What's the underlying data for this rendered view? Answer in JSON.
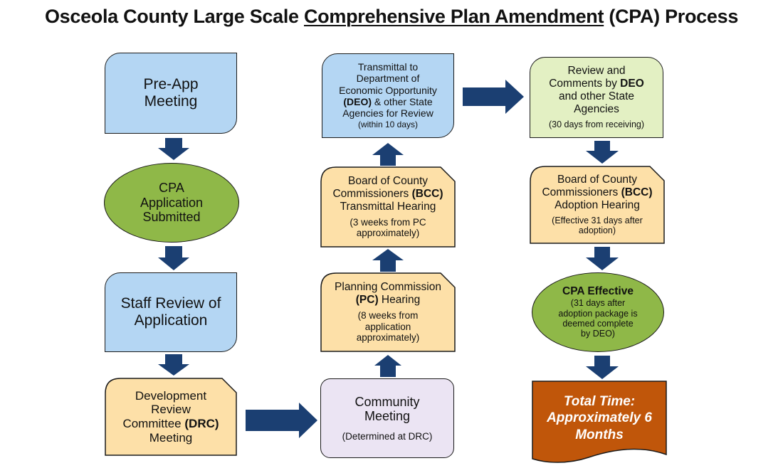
{
  "title": {
    "prefix": "Osceola County Large Scale ",
    "underlined": "Comprehensive Plan Amendment",
    "suffix": " (CPA) Process"
  },
  "colors": {
    "arrow": "#1b3f72",
    "blue_box": "#b4d6f3",
    "peach_box": "#fde0a8",
    "lavender_box": "#ebe4f3",
    "lime_box": "#e3f0c3",
    "green_ellipse": "#8fb848",
    "total_time_box": "#c0560a"
  },
  "steps": {
    "pre_app": {
      "line1": "Pre-App",
      "line2": "Meeting"
    },
    "cpa_submitted": {
      "line1": "CPA",
      "line2": "Application",
      "line3": "Submitted"
    },
    "staff_review": {
      "line1": "Staff Review of",
      "line2": "Application"
    },
    "drc": {
      "line1": "Development",
      "line2": "Review",
      "line3a": "Committee ",
      "line3b": "(DRC)",
      "line4": "Meeting"
    },
    "community": {
      "line1": "Community",
      "line2": "Meeting",
      "note": "(Determined at DRC)"
    },
    "pc_hearing": {
      "line1": "Planning Commission",
      "line2b": "(PC)",
      "line2": " Hearing",
      "note1": "(8 weeks from",
      "note2": "application",
      "note3": "approximately)"
    },
    "bcc_transmittal": {
      "line1": "Board of County",
      "line2a": "Commissioners ",
      "line2b": "(BCC)",
      "line3": "Transmittal Hearing",
      "note1": "(3 weeks from PC",
      "note2": "approximately)"
    },
    "transmittal_deo": {
      "line1": "Transmittal to",
      "line2": "Department of",
      "line3": "Economic Opportunity",
      "line4b": "(DEO)",
      "line4": " & other State",
      "line5": "Agencies for Review",
      "note": "(within 10 days)"
    },
    "deo_review": {
      "line1": "Review and",
      "line2a": "Comments by ",
      "line2b": "DEO",
      "line3": "and other State",
      "line4": "Agencies",
      "note": "(30 days from receiving)"
    },
    "bcc_adoption": {
      "line1": "Board of County",
      "line2a": "Commissioners ",
      "line2b": "(BCC)",
      "line3": "Adoption Hearing",
      "note1": "(Effective 31 days after",
      "note2": "adoption)"
    },
    "cpa_effective": {
      "heading": "CPA Effective",
      "note1": "(31 days after",
      "note2": "adoption package is",
      "note3": "deemed complete",
      "note4": "by DEO)"
    },
    "total_time": {
      "line1": "Total Time:",
      "line2": "Approximately 6",
      "line3": "Months"
    }
  }
}
